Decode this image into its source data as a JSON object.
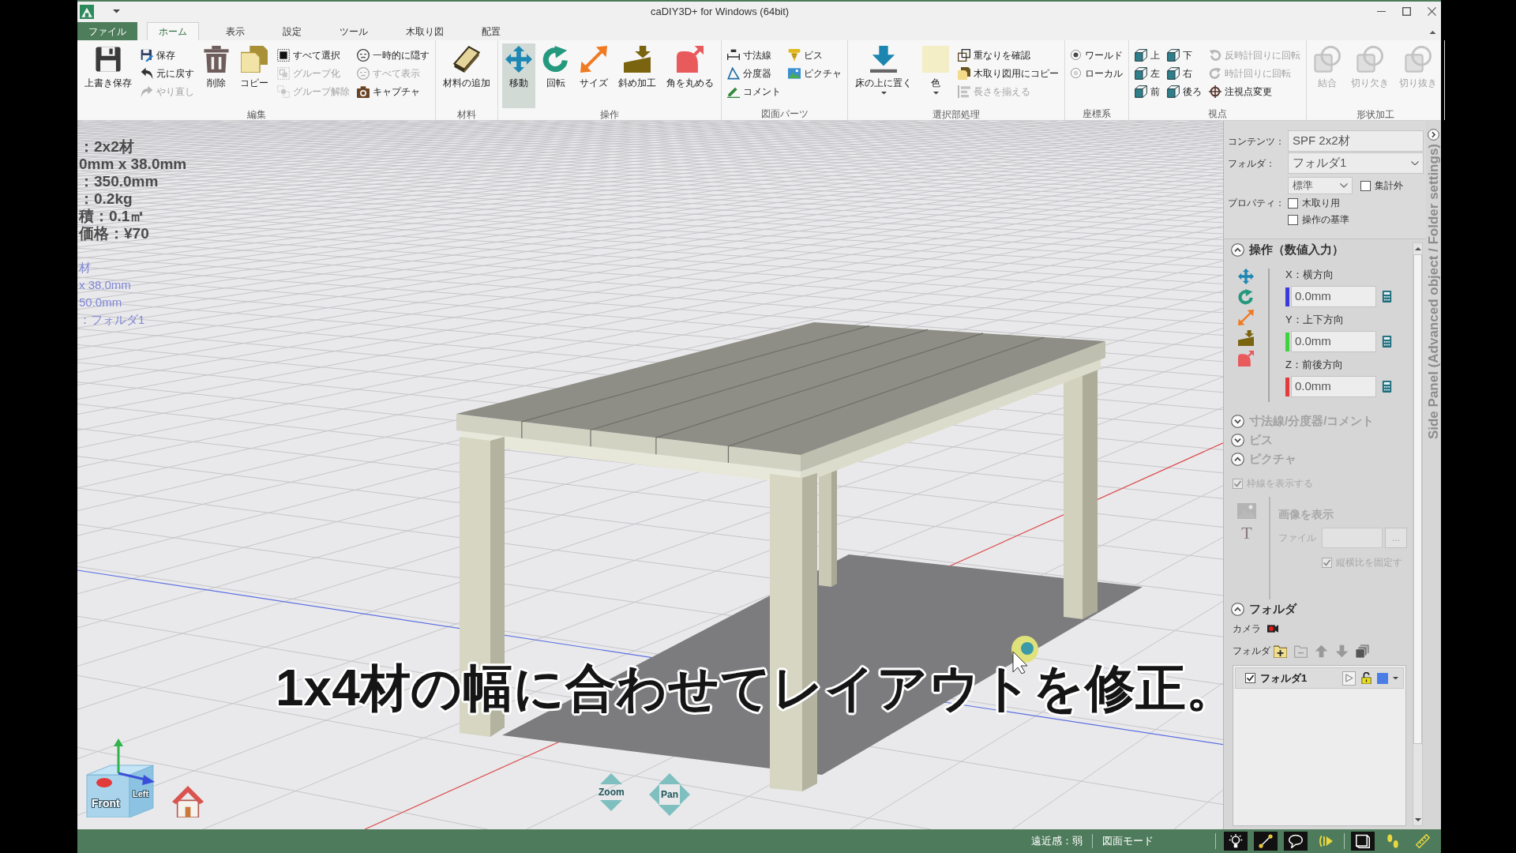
{
  "window": {
    "title": "caDIY3D+ for Windows (64bit)"
  },
  "ribbon": {
    "tabs": [
      {
        "label": "ファイル",
        "kind": "file",
        "selected": false
      },
      {
        "label": "ホーム",
        "kind": "tab",
        "selected": true
      },
      {
        "label": "表示",
        "kind": "tab",
        "selected": false
      },
      {
        "label": "設定",
        "kind": "tab",
        "selected": false
      },
      {
        "label": "ツール",
        "kind": "tab",
        "selected": false
      },
      {
        "label": "木取り図",
        "kind": "tab",
        "selected": false
      },
      {
        "label": "配置",
        "kind": "tab",
        "selected": false
      }
    ],
    "groups": [
      {
        "label": "編集",
        "columns": [
          {
            "kind": "large",
            "buttons": [
              {
                "label": "上書き保存",
                "disabled": false
              }
            ]
          },
          {
            "kind": "small",
            "buttons": [
              {
                "label": "保存",
                "disabled": false
              },
              {
                "label": "元に戻す",
                "disabled": false
              },
              {
                "label": "やり直し",
                "disabled": true
              }
            ]
          },
          {
            "kind": "large",
            "buttons": [
              {
                "label": "削除",
                "disabled": false
              }
            ]
          },
          {
            "kind": "large",
            "buttons": [
              {
                "label": "コピー",
                "disabled": false
              }
            ]
          },
          {
            "kind": "small",
            "buttons": [
              {
                "label": "すべて選択",
                "disabled": false
              },
              {
                "label": "グループ化",
                "disabled": true
              },
              {
                "label": "グループ解除",
                "disabled": true
              }
            ]
          },
          {
            "kind": "small",
            "buttons": [
              {
                "label": "一時的に隠す",
                "disabled": false
              },
              {
                "label": "すべて表示",
                "disabled": true
              },
              {
                "label": "キャプチャ",
                "disabled": false
              }
            ]
          }
        ]
      },
      {
        "label": "材料",
        "columns": [
          {
            "kind": "large",
            "buttons": [
              {
                "label": "材料の追加",
                "disabled": false
              }
            ]
          }
        ]
      },
      {
        "label": "操作",
        "columns": [
          {
            "kind": "large",
            "buttons": [
              {
                "label": "移動",
                "disabled": false,
                "selected": true
              }
            ]
          },
          {
            "kind": "large",
            "buttons": [
              {
                "label": "回転",
                "disabled": false,
                "selected": false
              }
            ]
          },
          {
            "kind": "large",
            "buttons": [
              {
                "label": "サイズ",
                "disabled": false,
                "selected": false
              }
            ]
          },
          {
            "kind": "large",
            "buttons": [
              {
                "label": "斜め加工",
                "disabled": false,
                "selected": false
              }
            ]
          },
          {
            "kind": "large",
            "buttons": [
              {
                "label": "角を丸める",
                "disabled": false,
                "selected": false
              }
            ]
          }
        ]
      },
      {
        "label": "図面パーツ",
        "columns": [
          {
            "kind": "small",
            "buttons": [
              {
                "label": "寸法線",
                "disabled": false
              },
              {
                "label": "分度器",
                "disabled": false
              },
              {
                "label": "コメント",
                "disabled": false
              }
            ]
          },
          {
            "kind": "small",
            "buttons": [
              {
                "label": "ビス",
                "disabled": false
              },
              {
                "label": "ピクチャ",
                "disabled": false
              }
            ]
          }
        ]
      },
      {
        "label": "選択部処理",
        "columns": [
          {
            "kind": "large",
            "buttons": [
              {
                "label": "床の上に置く",
                "disabled": false,
                "dropdown": true
              }
            ]
          },
          {
            "kind": "large",
            "buttons": [
              {
                "label": "色",
                "disabled": false,
                "dropdown": true,
                "color": "#f3eec6"
              }
            ]
          },
          {
            "kind": "small",
            "buttons": [
              {
                "label": "重なりを確認",
                "disabled": false
              },
              {
                "label": "木取り図用にコピー",
                "disabled": false
              },
              {
                "label": "長さを揃える",
                "disabled": true
              }
            ]
          }
        ]
      },
      {
        "label": "座標系",
        "columns": [
          {
            "kind": "radio",
            "buttons": [
              {
                "label": "ワールド",
                "disabled": false,
                "selected": true
              },
              {
                "label": "ローカル",
                "disabled": false,
                "selected": false
              }
            ]
          }
        ]
      },
      {
        "label": "視点",
        "columns": [
          {
            "kind": "small",
            "buttons": [
              {
                "label": "上",
                "disabled": false
              },
              {
                "label": "左",
                "disabled": false
              },
              {
                "label": "前",
                "disabled": false
              }
            ]
          },
          {
            "kind": "small",
            "buttons": [
              {
                "label": "下",
                "disabled": false
              },
              {
                "label": "右",
                "disabled": false
              },
              {
                "label": "後ろ",
                "disabled": false
              }
            ]
          },
          {
            "kind": "small",
            "buttons": [
              {
                "label": "反時計回りに回転",
                "disabled": true
              },
              {
                "label": "時計回りに回転",
                "disabled": true
              },
              {
                "label": "注視点変更",
                "disabled": false
              }
            ]
          }
        ]
      },
      {
        "label": "形状加工",
        "columns": [
          {
            "kind": "large",
            "buttons": [
              {
                "label": "結合",
                "disabled": true
              }
            ]
          },
          {
            "kind": "large",
            "buttons": [
              {
                "label": "切り欠き",
                "disabled": true
              }
            ]
          },
          {
            "kind": "large",
            "buttons": [
              {
                "label": "切り抜き",
                "disabled": true
              }
            ]
          }
        ]
      }
    ]
  },
  "viewport": {
    "info": [
      {
        "text": "：2x2材",
        "kind": "selected"
      },
      {
        "text": "0mm x 38.0mm",
        "kind": "selected"
      },
      {
        "text": "：350.0mm",
        "kind": "selected"
      },
      {
        "text": "：0.2kg",
        "kind": "selected"
      },
      {
        "text": "積：0.1㎡",
        "kind": "selected"
      },
      {
        "text": "価格：¥70",
        "kind": "selected"
      },
      {
        "text": "材",
        "kind": "hover"
      },
      {
        "text": "x 38.0mm",
        "kind": "hover"
      },
      {
        "text": "50.0mm",
        "kind": "hover"
      },
      {
        "text": "：フォルダ1",
        "kind": "hover"
      }
    ],
    "view_cube": {
      "front": "Front",
      "side": "Left"
    },
    "zoom": "Zoom",
    "pan": "Pan",
    "subtitle": "1x4材の幅に合わせてレイアウトを修正。"
  },
  "side_panel": {
    "vertical_title": "Side Panel (Advanced object / Folder settings)",
    "properties": {
      "content_label": "コンテンツ：",
      "content_value": "SPF 2x2材",
      "folder_label": "フォルダ：",
      "folder_value": "フォルダ1",
      "type_value": "標準",
      "property_label": "プロパティ：",
      "checkboxes": [
        {
          "label": "集計外",
          "checked": false
        },
        {
          "label": "木取り用",
          "checked": false
        },
        {
          "label": "操作の基準",
          "checked": false
        }
      ]
    },
    "sections": [
      {
        "kind": "operation",
        "title": "操作（数値入力）",
        "expanded": true,
        "disabled": false,
        "fields": [
          {
            "label": "X：横方向",
            "value": "0.0mm",
            "color": "#3b3bdb"
          },
          {
            "label": "Y：上下方向",
            "value": "0.0mm",
            "color": "#3fd43f"
          },
          {
            "label": "Z：前後方向",
            "value": "0.0mm",
            "color": "#e23b3b"
          }
        ]
      },
      {
        "kind": "dimension",
        "title": "寸法線/分度器/コメント",
        "expanded": false,
        "disabled": true
      },
      {
        "kind": "screw",
        "title": "ビス",
        "expanded": false,
        "disabled": true
      },
      {
        "kind": "picture",
        "title": "ピクチャ",
        "expanded": true,
        "disabled": true,
        "frame_checkbox": {
          "label": "枠線を表示する",
          "checked": true
        },
        "text_icon": "T",
        "heading": "画像を表示",
        "file_label": "ファイル",
        "browse": "...",
        "ratio_checkbox": {
          "label": "縦横比を固定す",
          "checked": true
        }
      },
      {
        "kind": "folder",
        "title": "フォルダ",
        "expanded": true,
        "disabled": false,
        "camera_label": "カメラ",
        "folder_label": "フォルダ",
        "folders": [
          {
            "name": "フォルダ1",
            "visible": true,
            "selected": true,
            "locked": false,
            "color": "#4a7ee6"
          }
        ]
      }
    ]
  },
  "status_bar": {
    "texts": [
      "遠近感：弱",
      "図面モード"
    ],
    "toggles": [
      {
        "on": true
      },
      {
        "on": true
      },
      {
        "on": true
      },
      {
        "on": false
      },
      {
        "on": true
      },
      {
        "on": false
      },
      {
        "on": false
      }
    ]
  }
}
